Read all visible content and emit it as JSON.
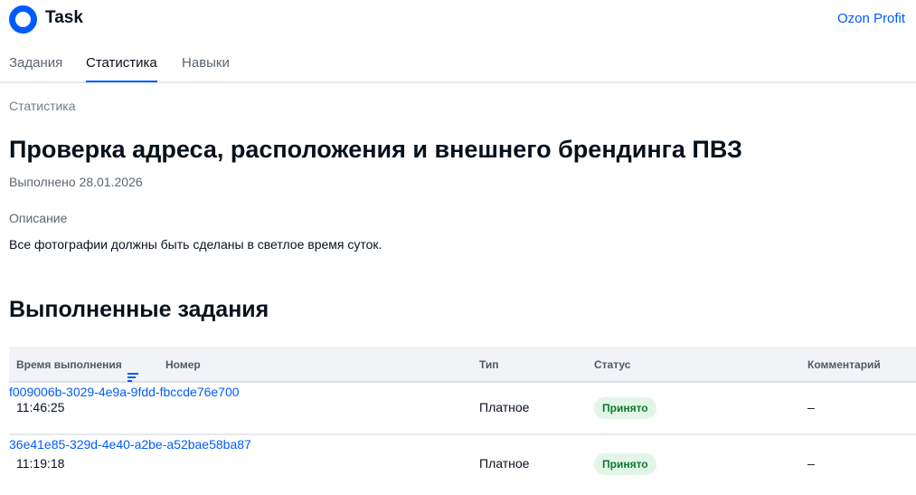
{
  "header": {
    "app_title": "Task",
    "profit_link": "Ozon Profit"
  },
  "tabs": [
    {
      "label": "Задания"
    },
    {
      "label": "Статистика",
      "active": true
    },
    {
      "label": "Навыки"
    }
  ],
  "breadcrumb": "Статистика",
  "task": {
    "title": "Проверка адреса, расположения и внешнего брендинга ПВЗ",
    "completed": "Выполнено 28.01.2026",
    "description_label": "Описание",
    "description": "Все фотографии должны быть сделаны в светлое время суток."
  },
  "section_title": "Выполненные задания",
  "table": {
    "columns": [
      "Время выполнения",
      "Номер",
      "Тип",
      "Статус",
      "Комментарий"
    ],
    "rows": [
      {
        "time": "11:46:25",
        "number": "f009006b-3029-4e9a-9fdd-fbccde76e700",
        "type": "Платное",
        "status": "Принято",
        "comment": "–"
      },
      {
        "time": "11:19:18",
        "number": "36e41e85-329d-4e40-a2be-a52bae58ba87",
        "type": "Платное",
        "status": "Принято",
        "comment": "–"
      }
    ]
  },
  "colors": {
    "accent": "#005bff",
    "status_bg": "#e3f5e7",
    "status_text": "#0d7a2f"
  }
}
